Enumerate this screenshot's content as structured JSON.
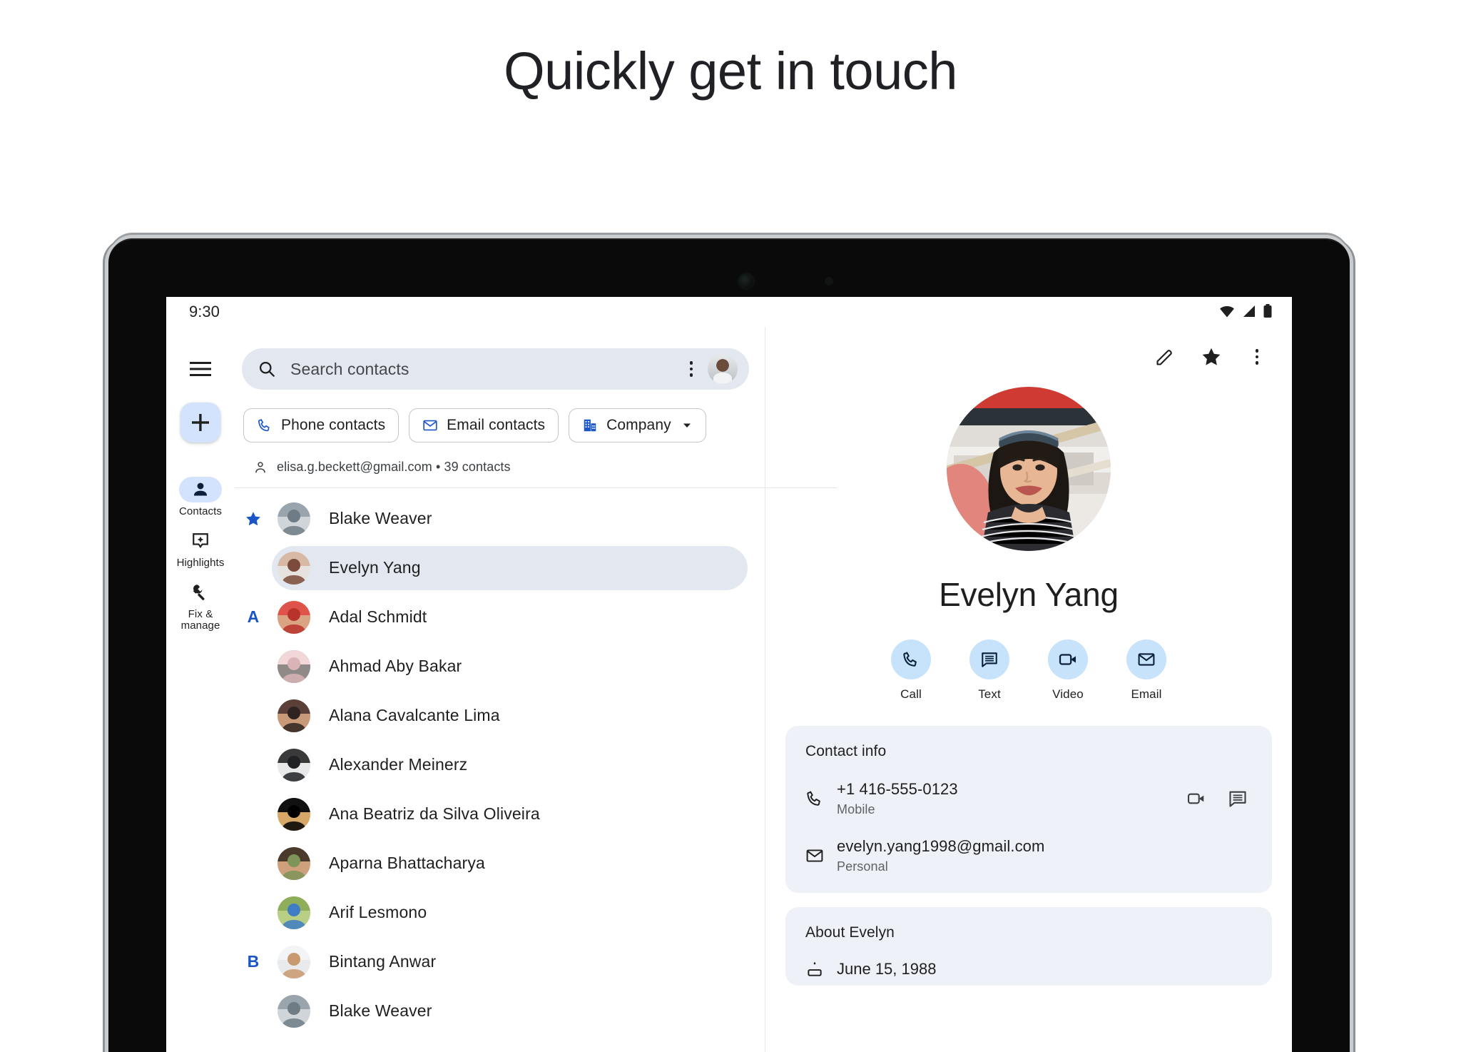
{
  "page": {
    "headline": "Quickly get in touch"
  },
  "status_bar": {
    "time": "9:30",
    "icons": [
      "wifi-icon",
      "cellular-signal-icon",
      "battery-icon"
    ]
  },
  "rail": {
    "menu_icon": "hamburger-menu-icon",
    "fab_label": "+",
    "items": [
      {
        "label": "Contacts",
        "icon": "person-icon",
        "active": true
      },
      {
        "label": "Highlights",
        "icon": "highlights-sparkle-icon",
        "active": false
      },
      {
        "label": "Fix & manage",
        "icon": "wrench-icon",
        "active": false
      }
    ]
  },
  "search": {
    "placeholder": "Search contacts",
    "icon": "search-icon",
    "overflow_icon": "more-vertical-icon",
    "avatar": "account-avatar"
  },
  "chips": [
    {
      "label": "Phone contacts",
      "icon": "phone-icon",
      "has_caret": false
    },
    {
      "label": "Email contacts",
      "icon": "email-icon",
      "has_caret": false
    },
    {
      "label": "Company",
      "icon": "company-building-icon",
      "has_caret": true
    }
  ],
  "account_line": {
    "icon": "person-outline-icon",
    "text": "elisa.g.beckett@gmail.com • 39 contacts"
  },
  "contacts": [
    {
      "letter": "★",
      "letter_type": "star",
      "name": "Blake Weaver",
      "selected": false,
      "avatar_colors": [
        "#9aa4ad",
        "#6f7c85",
        "#cfd5d9"
      ]
    },
    {
      "letter": "",
      "letter_type": "none",
      "name": "Evelyn Yang",
      "selected": true,
      "avatar_colors": [
        "#d8b9a6",
        "#7a4a3a",
        "#e6e3df"
      ]
    },
    {
      "letter": "A",
      "letter_type": "letter",
      "name": "Adal Schmidt",
      "selected": false,
      "avatar_colors": [
        "#e0534b",
        "#b9322c",
        "#d9a384"
      ]
    },
    {
      "letter": "",
      "letter_type": "none",
      "name": "Ahmad Aby Bakar",
      "selected": false,
      "avatar_colors": [
        "#f2d7d9",
        "#d9b3b6",
        "#8f8a87"
      ]
    },
    {
      "letter": "",
      "letter_type": "none",
      "name": "Alana Cavalcante Lima",
      "selected": false,
      "avatar_colors": [
        "#5a4038",
        "#2e2320",
        "#c99a7a"
      ]
    },
    {
      "letter": "",
      "letter_type": "none",
      "name": "Alexander Meinerz",
      "selected": false,
      "avatar_colors": [
        "#3a3a3a",
        "#1f2124",
        "#e9e9ea"
      ]
    },
    {
      "letter": "",
      "letter_type": "none",
      "name": "Ana Beatriz da Silva Oliveira",
      "selected": false,
      "avatar_colors": [
        "#111111",
        "#000000",
        "#d6a767"
      ]
    },
    {
      "letter": "",
      "letter_type": "none",
      "name": "Aparna Bhattacharya",
      "selected": false,
      "avatar_colors": [
        "#4a3a2c",
        "#7f9459",
        "#cfa07c"
      ]
    },
    {
      "letter": "",
      "letter_type": "none",
      "name": "Arif Lesmono",
      "selected": false,
      "avatar_colors": [
        "#8fae5c",
        "#3f7cc4",
        "#b9cf86"
      ]
    },
    {
      "letter": "B",
      "letter_type": "letter",
      "name": "Bintang Anwar",
      "selected": false,
      "avatar_colors": [
        "#f3f4f6",
        "#c9996f",
        "#e8eaec"
      ]
    },
    {
      "letter": "",
      "letter_type": "none",
      "name": "Blake Weaver",
      "selected": false,
      "avatar_colors": [
        "#9aa4ad",
        "#6f7c85",
        "#cfd5d9"
      ]
    }
  ],
  "detail": {
    "actions": [
      {
        "icon": "edit-pencil-icon",
        "name": "edit"
      },
      {
        "icon": "star-filled-icon",
        "name": "favorite"
      },
      {
        "icon": "more-vertical-icon",
        "name": "overflow"
      }
    ],
    "name": "Evelyn Yang",
    "photo": "evelyn-yang-photo",
    "quick_actions": [
      {
        "label": "Call",
        "icon": "phone-icon"
      },
      {
        "label": "Text",
        "icon": "message-icon"
      },
      {
        "label": "Video",
        "icon": "video-camera-icon"
      },
      {
        "label": "Email",
        "icon": "email-icon"
      }
    ],
    "contact_info": {
      "title": "Contact info",
      "rows": [
        {
          "icon": "phone-icon",
          "primary": "+1 416-555-0123",
          "secondary": "Mobile",
          "trailing_icons": [
            "video-camera-icon",
            "message-icon"
          ]
        },
        {
          "icon": "email-icon",
          "primary": "evelyn.yang1998@gmail.com",
          "secondary": "Personal",
          "trailing_icons": []
        }
      ]
    },
    "about": {
      "title": "About Evelyn",
      "rows": [
        {
          "icon": "cake-icon",
          "primary": "June 15, 1988"
        }
      ]
    }
  },
  "colors": {
    "accent_blue": "#1a56c7",
    "chip_icon_blue": "#1a56c7",
    "fab_bg": "#d3e3fd",
    "selected_row_bg": "#e3e8f0",
    "card_bg": "#eef1f8",
    "quick_action_bg": "#c7e2fb",
    "text_primary": "#1f1f1f",
    "text_secondary": "#5f6368"
  }
}
